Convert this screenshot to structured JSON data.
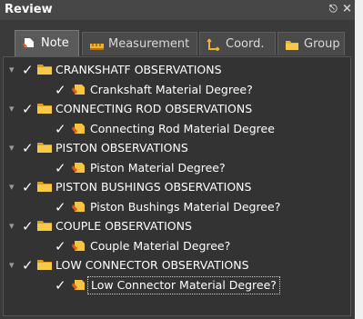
{
  "panel": {
    "title": "Review",
    "pin_glyph": "ᵖ",
    "close_glyph": "×"
  },
  "tabs": [
    {
      "label": "Note",
      "icon": "note-icon",
      "active": true
    },
    {
      "label": "Measurement",
      "icon": "ruler-icon",
      "active": false
    },
    {
      "label": "Coord.",
      "icon": "coordinate-icon",
      "active": false
    },
    {
      "label": "Group",
      "icon": "folder-icon",
      "active": false
    }
  ],
  "tree": {
    "groups": [
      {
        "label": "CRANKSHATF OBSERVATIONS",
        "child": "Crankshaft Material Degree?"
      },
      {
        "label": "CONNECTING ROD OBSERVATIONS",
        "child": "Connecting Rod Material Degree"
      },
      {
        "label": "PISTON OBSERVATIONS",
        "child": "Piston Material Degree?"
      },
      {
        "label": "PISTON BUSHINGS OBSERVATIONS",
        "child": "Piston Bushings Material Degree?"
      },
      {
        "label": "COUPLE OBSERVATIONS",
        "child": "Couple Material Degree?"
      },
      {
        "label": "LOW CONNECTOR OBSERVATIONS",
        "child": "Low Connector Material Degree?"
      }
    ]
  },
  "colors": {
    "panel_bg": "#3a3a3a",
    "folder": "#f0b429",
    "note": "#f5c542",
    "text": "#ffffff"
  }
}
